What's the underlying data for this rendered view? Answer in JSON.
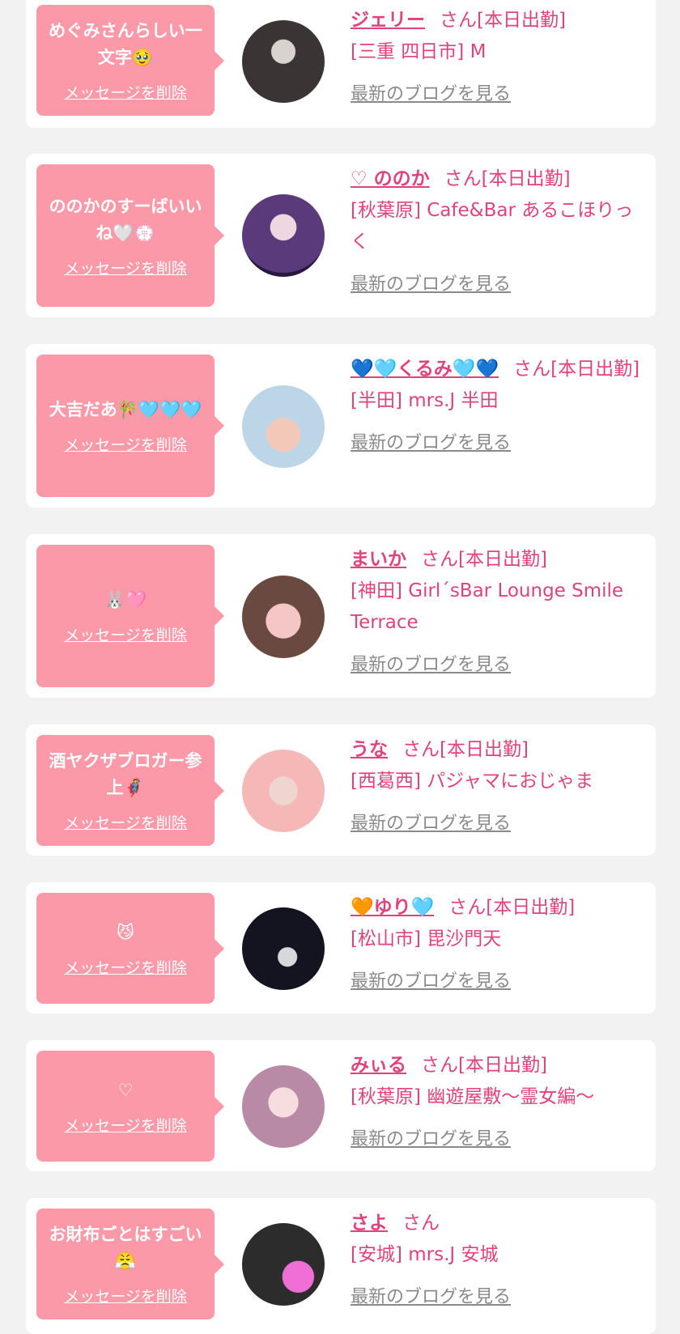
{
  "del_label": "メッセージを削除",
  "blog_label": "最新のブログを見る",
  "san_label": "さん",
  "colors": {
    "background": "#f2f2f2",
    "card": "#ffffff",
    "bubble": "#fb99a8",
    "accent_pink": "#e0437a",
    "link_gray": "#8a8a8a"
  },
  "items": [
    {
      "message": "めぐみさんらしい一文字🥹",
      "name": "ジェリー",
      "status": "[本日出勤]",
      "shop": "[三重 四日市] M"
    },
    {
      "message": "ののかのすーばいいね🤍💮",
      "name": "♡ ののか",
      "status": "[本日出勤]",
      "shop": "[秋葉原] Cafe&Bar あるこほりっく"
    },
    {
      "message": "大吉だあ🎋🩵🩵🩵",
      "name": "💙🩵くるみ🩵💙",
      "status": "[本日出勤]",
      "shop": "[半田] mrs.J 半田"
    },
    {
      "message": "🐰🩷",
      "name": "まいか",
      "status": "[本日出勤]",
      "shop": "[神田] Girl´sBar Lounge Smile Terrace"
    },
    {
      "message": "酒ヤクザブロガー参上🦸",
      "name": "うな",
      "status": "[本日出勤]",
      "shop": "[西葛西] パジャマにおじゃま"
    },
    {
      "message": "😼",
      "name": "🧡ゆり🩵",
      "status": "[本日出勤]",
      "shop": "[松山市] 毘沙門天"
    },
    {
      "message": "♡",
      "name": "みぃる",
      "status": "[本日出勤]",
      "shop": "[秋葉原] 幽遊屋敷〜霊女編〜"
    },
    {
      "message": "お財布ごとはすごい😤",
      "name": "さよ",
      "status": "",
      "shop": "[安城] mrs.J 安城"
    }
  ]
}
